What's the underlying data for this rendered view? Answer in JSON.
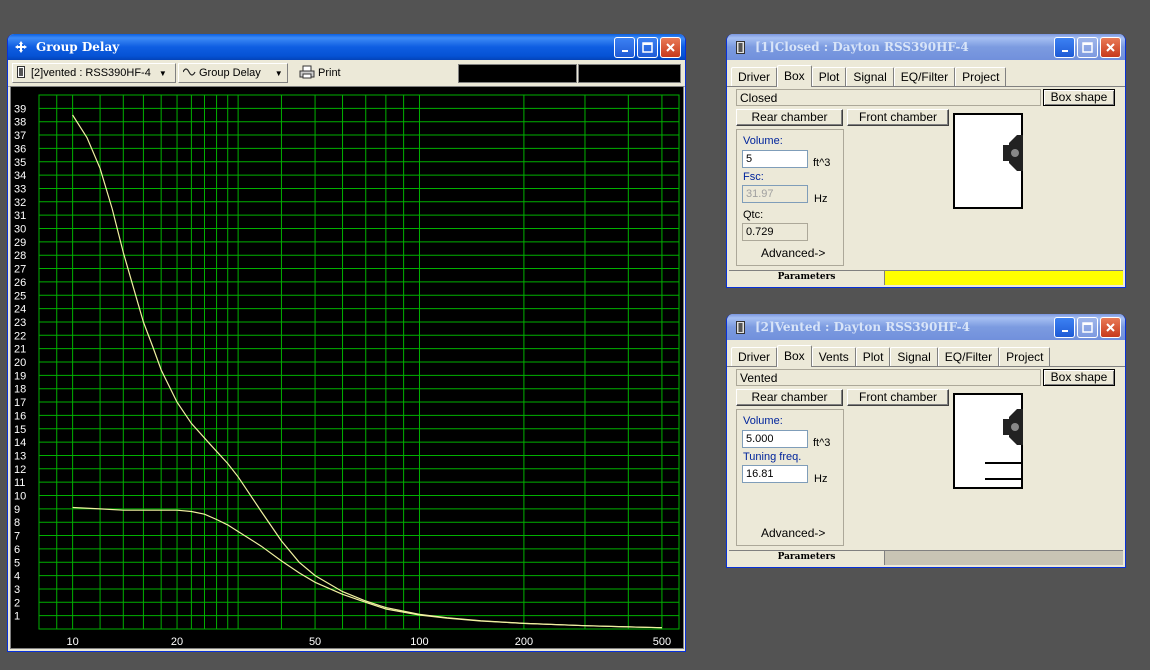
{
  "colors": {
    "desktop": "#535353",
    "title_active": "#0552d4",
    "plot_bg": "#000000",
    "grid": "#00b000",
    "curve": "#f0f0a0",
    "status_yellow": "#ffff00"
  },
  "group_delay_window": {
    "title": "Group Delay",
    "title_icon": "move-cross-icon",
    "toolbar": {
      "project_select": "[2]vented : RSS390HF-4",
      "plot_type": "Group Delay",
      "print_label": "Print"
    }
  },
  "chart_data": {
    "type": "line",
    "title": "",
    "xlabel": "",
    "ylabel": "",
    "x_scale": "log",
    "xlim": [
      8,
      560
    ],
    "ylim": [
      0,
      40
    ],
    "grid": true,
    "x_tick_labels": [
      "10",
      "20",
      "50",
      "100",
      "200",
      "500"
    ],
    "x_ticks": [
      10,
      20,
      50,
      100,
      200,
      500
    ],
    "y_ticks": [
      1,
      2,
      3,
      4,
      5,
      6,
      7,
      8,
      9,
      10,
      11,
      12,
      13,
      14,
      15,
      16,
      17,
      18,
      19,
      20,
      21,
      22,
      23,
      24,
      25,
      26,
      27,
      28,
      29,
      30,
      31,
      32,
      33,
      34,
      35,
      36,
      37,
      38,
      39
    ],
    "series": [
      {
        "name": "",
        "color": "#f0f0a0",
        "x": [
          10,
          11,
          12,
          13,
          14,
          15,
          16,
          17,
          18,
          20,
          22,
          25,
          28,
          30,
          35,
          40,
          45,
          50,
          60,
          70,
          80,
          100,
          120,
          150,
          200,
          300,
          400,
          500
        ],
        "y": [
          38.5,
          36.8,
          34.5,
          31.5,
          28.2,
          25.5,
          23.0,
          21.2,
          19.4,
          17.0,
          15.4,
          13.8,
          12.4,
          11.4,
          8.8,
          6.6,
          5.0,
          4.0,
          2.8,
          2.1,
          1.6,
          1.1,
          0.85,
          0.62,
          0.42,
          0.25,
          0.16,
          0.1
        ]
      },
      {
        "name": "",
        "color": "#f0f0a0",
        "x": [
          10,
          12,
          14,
          16,
          18,
          20,
          22,
          24,
          26,
          28,
          30,
          35,
          40,
          45,
          50,
          60,
          70,
          80,
          100,
          120,
          150,
          200,
          300,
          400,
          500
        ],
        "y": [
          9.1,
          9.0,
          8.9,
          8.9,
          8.9,
          8.9,
          8.8,
          8.6,
          8.2,
          7.8,
          7.3,
          6.2,
          5.1,
          4.2,
          3.5,
          2.6,
          2.0,
          1.5,
          1.05,
          0.82,
          0.6,
          0.42,
          0.25,
          0.16,
          0.1
        ]
      }
    ]
  },
  "closed_window": {
    "title": "[1]Closed : Dayton RSS390HF-4",
    "tabs": [
      "Driver",
      "Box",
      "Plot",
      "Signal",
      "EQ/Filter",
      "Project"
    ],
    "active_tab": "Box",
    "box_type": "Closed",
    "box_shape_button": "Box shape",
    "rear_chamber_button": "Rear chamber",
    "front_chamber_button": "Front chamber",
    "volume_label": "Volume:",
    "volume_value": "5",
    "volume_unit": "ft^3",
    "fsc_label": "Fsc:",
    "fsc_value": "31.97",
    "fsc_unit": "Hz",
    "qtc_label": "Qtc:",
    "qtc_value": "0.729",
    "advanced_button": "Advanced->",
    "status_label": "Parameters",
    "status_color": "#ffff00"
  },
  "vented_window": {
    "title": "[2]Vented : Dayton RSS390HF-4",
    "tabs": [
      "Driver",
      "Box",
      "Vents",
      "Plot",
      "Signal",
      "EQ/Filter",
      "Project"
    ],
    "active_tab": "Box",
    "box_type": "Vented",
    "box_shape_button": "Box shape",
    "rear_chamber_button": "Rear chamber",
    "front_chamber_button": "Front chamber",
    "volume_label": "Volume:",
    "volume_value": "5.000",
    "volume_unit": "ft^3",
    "tuning_label": "Tuning freq.",
    "tuning_value": "16.81",
    "tuning_unit": "Hz",
    "advanced_button": "Advanced->",
    "status_label": "Parameters"
  }
}
